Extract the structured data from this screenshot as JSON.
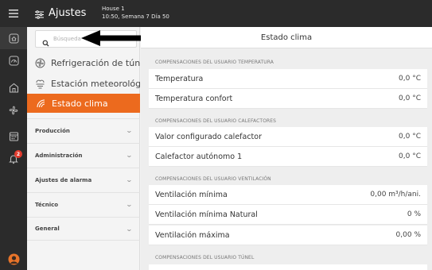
{
  "header": {
    "title": "Ajustes",
    "house": "House 1",
    "time": "10:50, Semana 7 Día 50"
  },
  "rail": {
    "icons": [
      "menu-icon",
      "home-icon",
      "gauge-icon",
      "barn-icon",
      "fan-icon",
      "calendar-icon",
      "bell-icon",
      "user-icon"
    ],
    "notification_count": "2"
  },
  "search": {
    "placeholder": "Búsqueda"
  },
  "menu": {
    "items": [
      {
        "label": "Refrigeración de túnel",
        "icon": "cooling-icon"
      },
      {
        "label": "Estación meteorológ...",
        "icon": "weather-station-icon"
      },
      {
        "label": "Estado clima",
        "icon": "climate-icon",
        "active": true
      }
    ],
    "sections": [
      "Producción",
      "Administración",
      "Ajustes de alarma",
      "Técnico",
      "General"
    ]
  },
  "main": {
    "title": "Estado clima",
    "groups": [
      {
        "label": "COMPENSACIONES DEL USUARIO TEMPERATURA",
        "rows": [
          {
            "name": "Temperatura",
            "value": "0,0 °C"
          },
          {
            "name": "Temperatura confort",
            "value": "0,0 °C"
          }
        ]
      },
      {
        "label": "COMPENSACIONES DEL USUARIO CALEFACTORES",
        "rows": [
          {
            "name": "Valor configurado calefactor",
            "value": "0,0 °C"
          },
          {
            "name": "Calefactor autónomo 1",
            "value": "0,0 °C"
          }
        ]
      },
      {
        "label": "COMPENSACIONES DEL USUARIO VENTILACIÓN",
        "rows": [
          {
            "name": "Ventilación mínima",
            "value": "0,00 m³/h/ani."
          },
          {
            "name": "Ventilación mínima Natural",
            "value": "0 %"
          },
          {
            "name": "Ventilación máxima",
            "value": "0,00 %"
          }
        ]
      },
      {
        "label": "COMPENSACIONES DEL USUARIO TÚNEL",
        "rows": []
      }
    ]
  },
  "colors": {
    "accent": "#ec6a1e",
    "dark": "#2b2b2b",
    "badge": "#e23b2e"
  }
}
